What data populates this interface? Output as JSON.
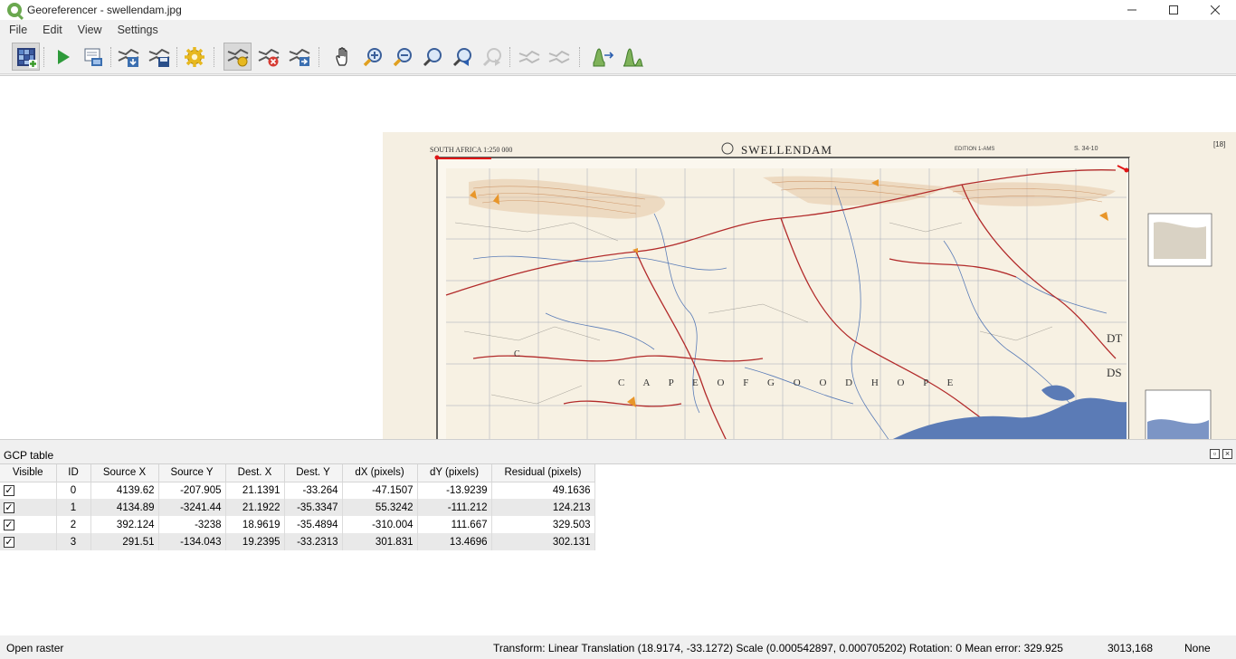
{
  "window": {
    "title": "Georeferencer - swellendam.jpg"
  },
  "menu": [
    "File",
    "Edit",
    "View",
    "Settings"
  ],
  "toolbar": {
    "buttons": [
      "open-raster",
      "start-georeferencing",
      "generate-gdal-script",
      "load-gcp-points",
      "save-gcp-points",
      "transformation-settings",
      "add-point",
      "delete-point",
      "move-gcp-point",
      "pan",
      "zoom-in",
      "zoom-out",
      "zoom-to-layer",
      "zoom-last",
      "zoom-next",
      "link-georeferencer-to-qgis",
      "link-qgis-to-georeferencer",
      "full-histogram-stretch",
      "local-histogram-stretch"
    ]
  },
  "map": {
    "sheet_title": "SWELLENDAM",
    "header_left": "SOUTH AFRICA 1:250 000",
    "header_right": "S. 34-10",
    "edition": "EDITION 1-AMS",
    "sheet_id": "[18]",
    "labels": [
      "C",
      "DT",
      "DS",
      "C A P E   O F   G O O D   H O P E"
    ],
    "water_color": "#5b7bb6",
    "road_color": "#b22a2a",
    "river_color": "#3f68b0",
    "relief_color": "#c98a58"
  },
  "gcp": {
    "title": "GCP table",
    "columns": [
      "Visible",
      "ID",
      "Source X",
      "Source Y",
      "Dest. X",
      "Dest. Y",
      "dX (pixels)",
      "dY (pixels)",
      "Residual (pixels)"
    ],
    "rows": [
      {
        "visible": "✓",
        "id": "0",
        "source_x": "4139.62",
        "source_y": "-207.905",
        "dest_x": "21.1391",
        "dest_y": "-33.264",
        "dx": "-47.1507",
        "dy": "-13.9239",
        "residual": "49.1636"
      },
      {
        "visible": "✓",
        "id": "1",
        "source_x": "4134.89",
        "source_y": "-3241.44",
        "dest_x": "21.1922",
        "dest_y": "-35.3347",
        "dx": "55.3242",
        "dy": "-111.212",
        "residual": "124.213"
      },
      {
        "visible": "✓",
        "id": "2",
        "source_x": "392.124",
        "source_y": "-3238",
        "dest_x": "18.9619",
        "dest_y": "-35.4894",
        "dx": "-310.004",
        "dy": "111.667",
        "residual": "329.503"
      },
      {
        "visible": "✓",
        "id": "3",
        "source_x": "291.51",
        "source_y": "-134.043",
        "dest_x": "19.2395",
        "dest_y": "-33.2313",
        "dx": "301.831",
        "dy": "13.4696",
        "residual": "302.131"
      }
    ]
  },
  "status": {
    "left": "Open raster",
    "transform": "Transform: Linear Translation (18.9174, -33.1272) Scale (0.000542897, 0.000705202) Rotation: 0 Mean error: 329.925",
    "coords": "3013,168",
    "crs": "None"
  }
}
